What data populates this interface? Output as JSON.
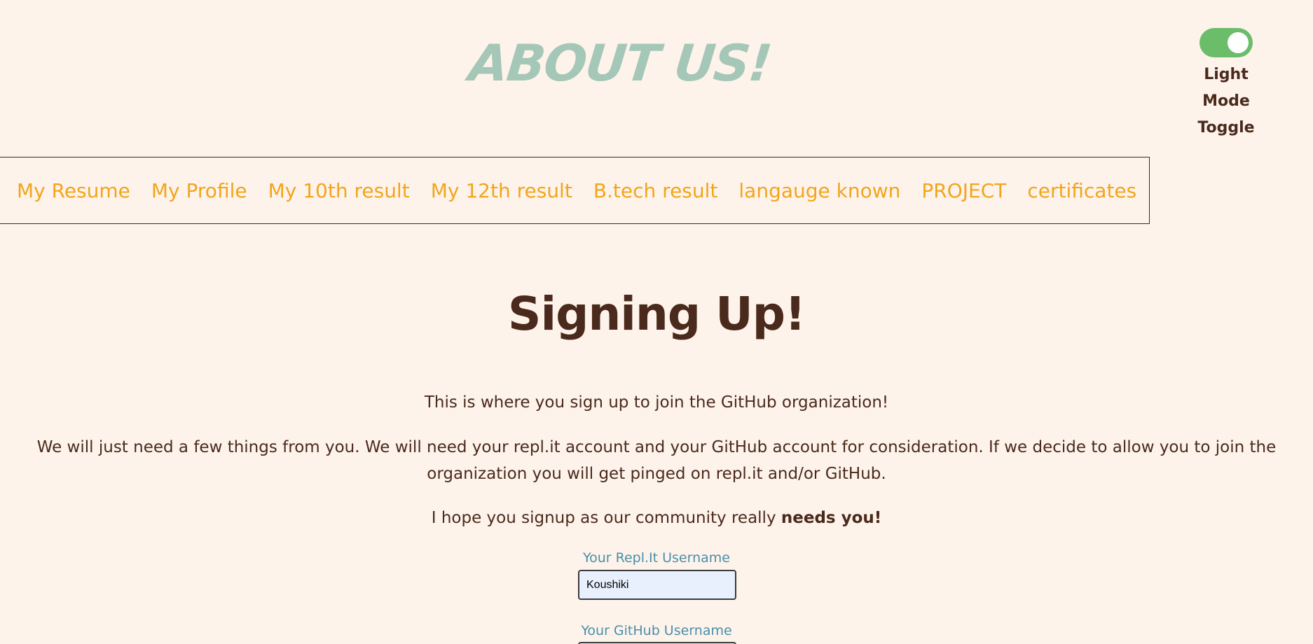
{
  "header": {
    "title": "About Us!"
  },
  "theme_toggle": {
    "label_line1": "Light",
    "label_line2": "Mode",
    "label_line3": "Toggle",
    "state": "on",
    "color": "#6bbd6a"
  },
  "nav": {
    "items": [
      {
        "label": "My Resume"
      },
      {
        "label": "My Profile"
      },
      {
        "label": "My 10th result"
      },
      {
        "label": "My 12th result"
      },
      {
        "label": "B.tech result"
      },
      {
        "label": "langauge known"
      },
      {
        "label": "PROJECT"
      },
      {
        "label": "certificates"
      }
    ],
    "link_color": "#f2a51c"
  },
  "main": {
    "title": "Signing Up!",
    "paragraph1": "This is where you sign up to join the GitHub organization!",
    "paragraph2": "We will just need a few things from you. We will need your repl.it account and your GitHub account for consideration. If we decide to allow you to join the organization you will get pinged on repl.it and/or GitHub.",
    "paragraph3_text": "I hope you signup as our community really ",
    "paragraph3_strong": "needs you!"
  },
  "form": {
    "replit_label": "Your Repl.It Username",
    "replit_value": "Koushiki",
    "github_label": "Your GitHub Username",
    "github_value": ""
  },
  "colors": {
    "background": "#fdf3eb",
    "text": "#4a2a1c",
    "header_title": "#a5c7b7",
    "field_label": "#4a8fa8"
  }
}
